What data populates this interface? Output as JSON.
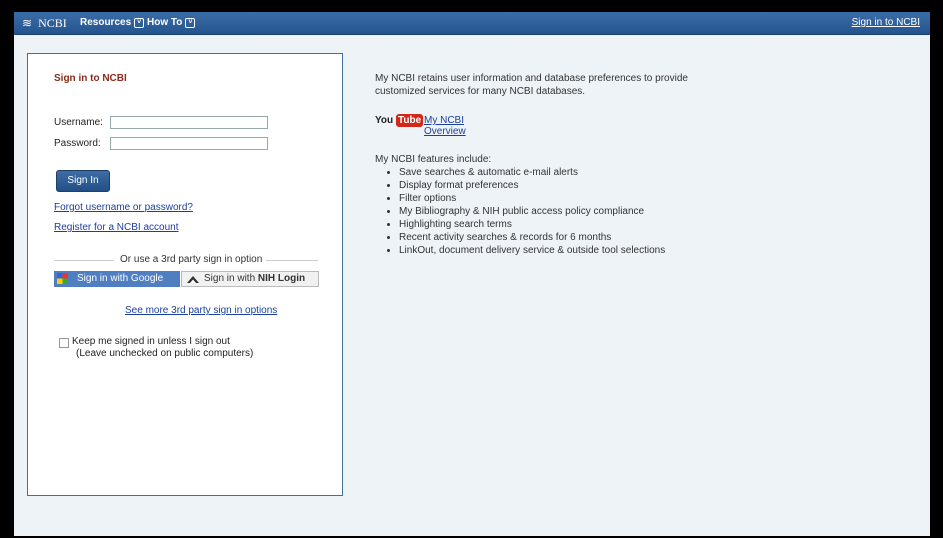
{
  "header": {
    "brand": "NCBI",
    "menu": [
      {
        "label": "Resources"
      },
      {
        "label": "How To"
      }
    ],
    "signin_link": "Sign in to NCBI"
  },
  "login_panel": {
    "title": "Sign in to NCBI",
    "username_label": "Username:",
    "username_value": "",
    "password_label": "Password:",
    "password_value": "",
    "signin_button": "Sign In",
    "forgot_link": "Forgot username or password?",
    "register_link": "Register for a NCBI account",
    "third_party_divider": "Or use a 3rd party sign in option",
    "google_button": "Sign in with Google",
    "nih_button_prefix": "Sign in with ",
    "nih_button_bold": "NIH Login",
    "more_options_link": "See more 3rd party sign in options",
    "keep_signed_in": "Keep me signed in unless I sign out",
    "keep_signed_in_note": "(Leave unchecked on public computers)"
  },
  "info": {
    "intro": "My NCBI retains user information and database preferences to provide customized services for many NCBI databases.",
    "youtube_you": "You",
    "youtube_tube": "Tube",
    "overview_link": "My NCBI Overview",
    "features_heading": "My NCBI features include:",
    "features": [
      "Save searches & automatic e-mail alerts",
      "Display format preferences",
      "Filter options",
      "My Bibliography & NIH public access policy compliance",
      "Highlighting search terms",
      "Recent activity searches & records for 6 months",
      "LinkOut, document delivery service & outside tool selections"
    ]
  },
  "colors": {
    "header_bar": "#2f5f9a",
    "link": "#1a3fa0",
    "panel_title": "#8a2b1b",
    "page_bg": "#eef3f8"
  }
}
